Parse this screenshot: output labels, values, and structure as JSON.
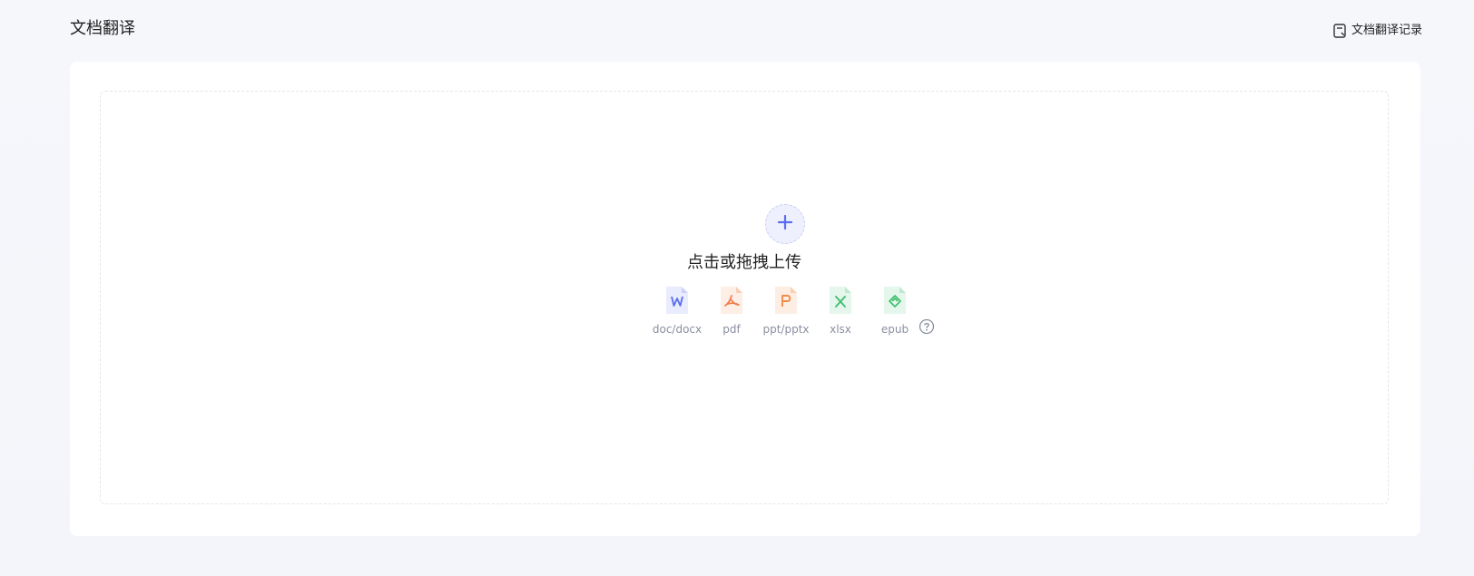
{
  "header": {
    "title": "文档翻译",
    "history_link_label": "文档翻译记录",
    "history_icon": "document-icon"
  },
  "upload": {
    "button_icon": "plus-icon",
    "prompt": "点击或拖拽上传",
    "accent_color": "#5b6cf0",
    "file_types": [
      {
        "label": "doc/docx",
        "icon": "word-file-icon",
        "color": "#5b6cf0"
      },
      {
        "label": "pdf",
        "icon": "pdf-file-icon",
        "color": "#f07a4a"
      },
      {
        "label": "ppt/pptx",
        "icon": "ppt-file-icon",
        "color": "#f28a4a"
      },
      {
        "label": "xlsx",
        "icon": "excel-file-icon",
        "color": "#3fbf6f"
      },
      {
        "label": "epub",
        "icon": "epub-file-icon",
        "color": "#3fbf6f"
      }
    ],
    "help_icon": "question-circle-icon"
  }
}
